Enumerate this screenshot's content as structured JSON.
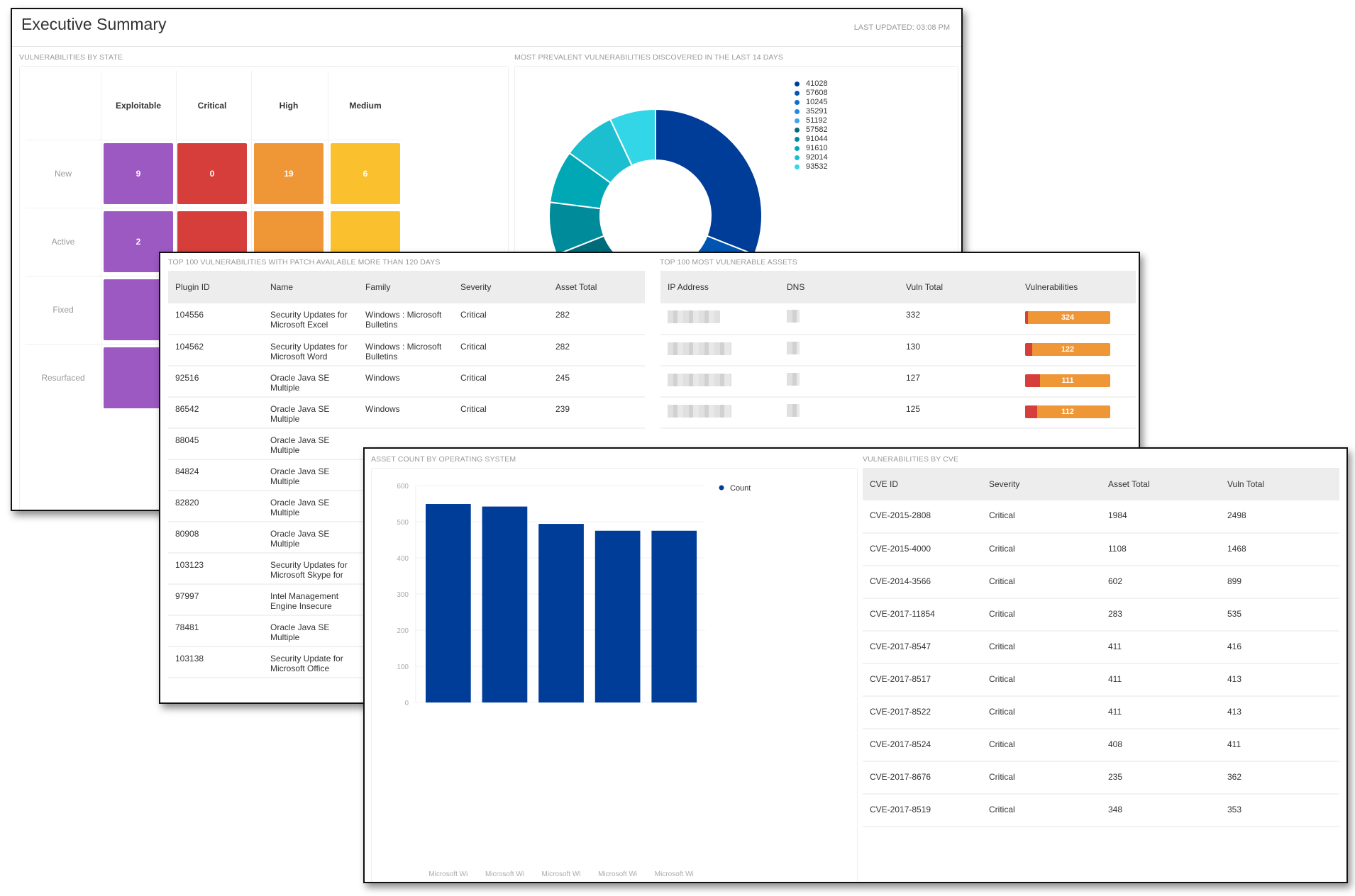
{
  "header": {
    "title": "Executive Summary",
    "last_updated": "LAST UPDATED: 03:08 PM"
  },
  "vulns_by_state": {
    "label": "VULNERABILITIES BY STATE",
    "columns": [
      "Exploitable",
      "Critical",
      "High",
      "Medium"
    ],
    "rows": [
      {
        "label": "New",
        "values": [
          "9",
          "0",
          "19",
          "6"
        ]
      },
      {
        "label": "Active",
        "values": [
          "2",
          "",
          "",
          ""
        ]
      },
      {
        "label": "Fixed",
        "values": [
          "",
          "",
          "",
          ""
        ]
      },
      {
        "label": "Resurfaced",
        "values": [
          "",
          "",
          "",
          ""
        ]
      }
    ],
    "colors": {
      "Exploitable": "#9b59c1",
      "Critical": "#d63e3b",
      "High": "#ef9637",
      "Medium": "#fbc02d"
    }
  },
  "prevalent": {
    "label": "MOST PREVALENT VULNERABILITIES DISCOVERED IN THE LAST 14 DAYS"
  },
  "patch_table": {
    "label": "TOP 100 VULNERABILITIES WITH PATCH AVAILABLE MORE THAN 120 DAYS",
    "columns": [
      "Plugin ID",
      "Name",
      "Family",
      "Severity",
      "Asset Total"
    ],
    "rows": [
      [
        "104556",
        "Security Updates for Microsoft Excel",
        "Windows : Microsoft Bulletins",
        "Critical",
        "282"
      ],
      [
        "104562",
        "Security Updates for Microsoft Word",
        "Windows : Microsoft Bulletins",
        "Critical",
        "282"
      ],
      [
        "92516",
        "Oracle Java SE Multiple",
        "Windows",
        "Critical",
        "245"
      ],
      [
        "86542",
        "Oracle Java SE Multiple",
        "Windows",
        "Critical",
        "239"
      ],
      [
        "88045",
        "Oracle Java SE Multiple",
        "",
        "",
        ""
      ],
      [
        "84824",
        "Oracle Java SE Multiple",
        "",
        "",
        ""
      ],
      [
        "82820",
        "Oracle Java SE Multiple",
        "",
        "",
        ""
      ],
      [
        "80908",
        "Oracle Java SE Multiple",
        "",
        "",
        ""
      ],
      [
        "103123",
        "Security Updates for Microsoft Skype for",
        "",
        "",
        ""
      ],
      [
        "97997",
        "Intel Management Engine Insecure",
        "",
        "",
        ""
      ],
      [
        "78481",
        "Oracle Java SE Multiple",
        "",
        "",
        ""
      ],
      [
        "103138",
        "Security Update for Microsoft Office",
        "",
        "",
        ""
      ]
    ]
  },
  "assets_table": {
    "label": "TOP 100 MOST VULNERABLE ASSETS",
    "columns": [
      "IP Address",
      "DNS",
      "Vuln Total",
      "Vulnerabilities"
    ],
    "rows": [
      {
        "ip": "",
        "dns": "",
        "vuln_total": "332",
        "critical": 8,
        "high": 324,
        "bar_label": "324"
      },
      {
        "ip": "",
        "dns": "",
        "vuln_total": "130",
        "critical": 8,
        "high": 122,
        "bar_label": "122"
      },
      {
        "ip": "",
        "dns": "",
        "vuln_total": "127",
        "critical": 16,
        "high": 111,
        "bar_label": "111"
      },
      {
        "ip": "",
        "dns": "",
        "vuln_total": "125",
        "critical": 13,
        "high": 112,
        "bar_label": "112"
      }
    ],
    "colors": {
      "critical": "#d63e3b",
      "high": "#ef9637"
    }
  },
  "cve_table": {
    "label": "VULNERABILITIES BY CVE",
    "columns": [
      "CVE ID",
      "Severity",
      "Asset Total",
      "Vuln Total"
    ],
    "rows": [
      [
        "CVE-2015-2808",
        "Critical",
        "1984",
        "2498"
      ],
      [
        "CVE-2015-4000",
        "Critical",
        "1108",
        "1468"
      ],
      [
        "CVE-2014-3566",
        "Critical",
        "602",
        "899"
      ],
      [
        "CVE-2017-11854",
        "Critical",
        "283",
        "535"
      ],
      [
        "CVE-2017-8547",
        "Critical",
        "411",
        "416"
      ],
      [
        "CVE-2017-8517",
        "Critical",
        "411",
        "413"
      ],
      [
        "CVE-2017-8522",
        "Critical",
        "411",
        "413"
      ],
      [
        "CVE-2017-8524",
        "Critical",
        "408",
        "411"
      ],
      [
        "CVE-2017-8676",
        "Critical",
        "235",
        "362"
      ],
      [
        "CVE-2017-8519",
        "Critical",
        "348",
        "353"
      ]
    ]
  },
  "chart_data": [
    {
      "type": "pie",
      "title": "MOST PREVALENT VULNERABILITIES DISCOVERED IN THE LAST 14 DAYS",
      "donut": true,
      "legend": "right",
      "categories": [
        "41028",
        "57608",
        "10245",
        "35291",
        "51192",
        "57582",
        "91044",
        "91610",
        "92014",
        "93532"
      ],
      "values": [
        31,
        9,
        8,
        7,
        7,
        7,
        8,
        8,
        8,
        7
      ],
      "colors": [
        "#003d99",
        "#0055b3",
        "#0a6fd1",
        "#2189e6",
        "#3ba3f0",
        "#006b7a",
        "#008b9a",
        "#00a8b5",
        "#1bbfcf",
        "#33d6e6"
      ]
    },
    {
      "type": "bar",
      "title": "ASSET COUNT BY OPERATING SYSTEM",
      "categories": [
        "Microsoft Wi",
        "Microsoft Wi",
        "Microsoft Wi",
        "Microsoft Wi",
        "Microsoft Wi"
      ],
      "series": [
        {
          "name": "Count",
          "values": [
            549,
            542,
            494,
            475,
            475
          ],
          "color": "#003d99"
        }
      ],
      "xlabel": "",
      "ylabel": "",
      "ylim": [
        0,
        600
      ],
      "yticks": [
        0,
        100,
        200,
        300,
        400,
        500,
        600
      ],
      "grid": true,
      "legend": "top-right"
    }
  ]
}
